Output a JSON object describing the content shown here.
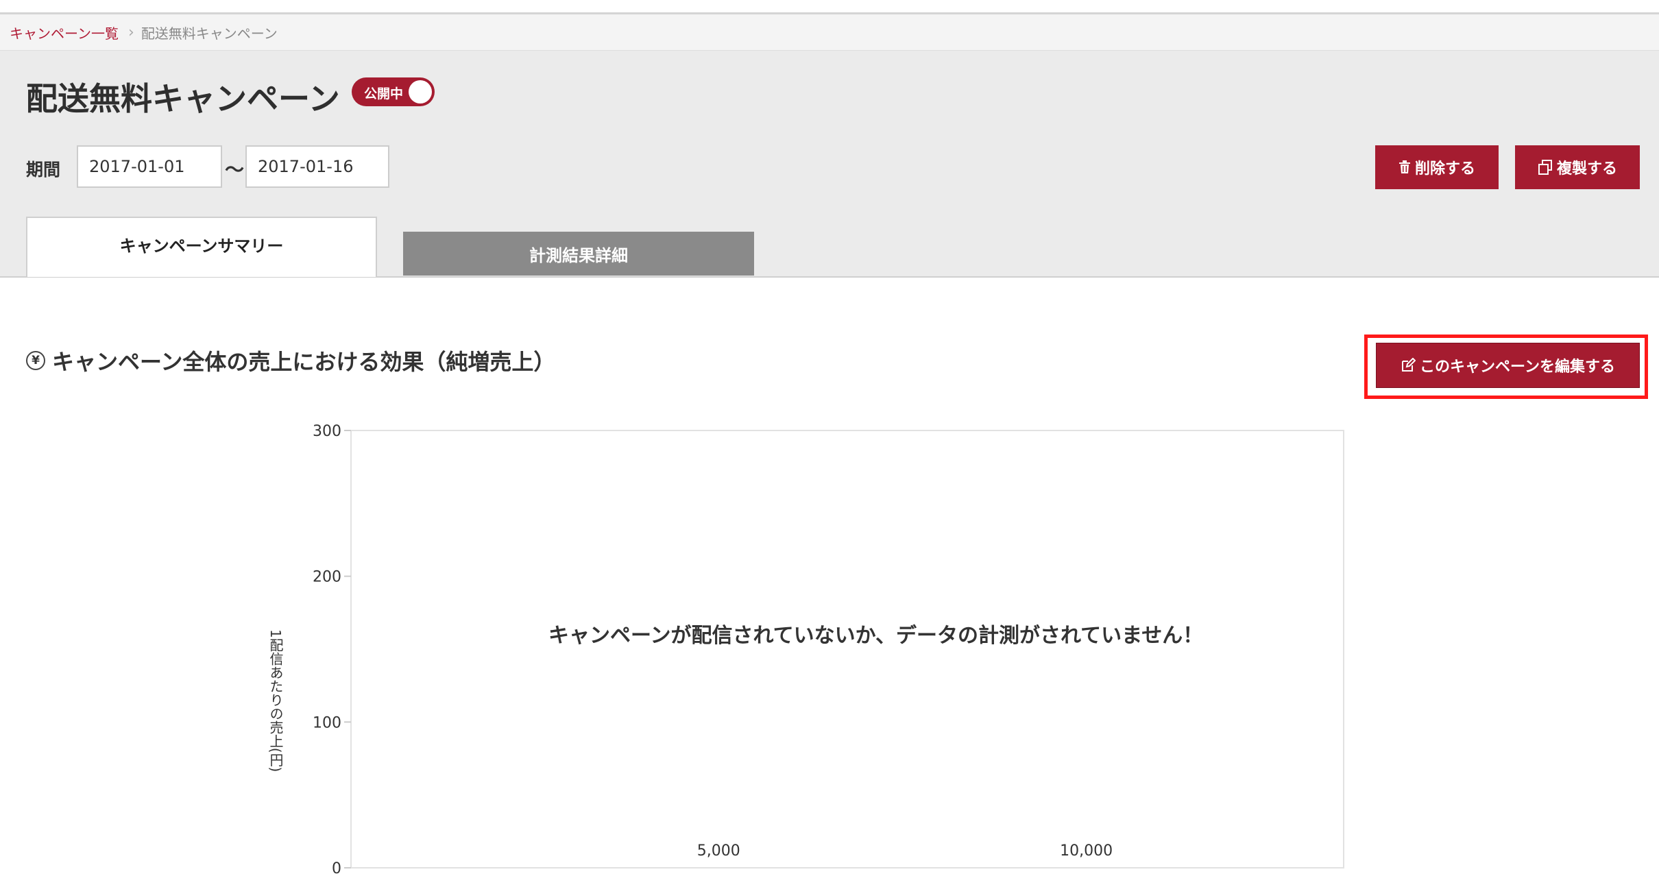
{
  "breadcrumb": {
    "parent": "キャンペーン一覧",
    "separator": "›",
    "current": "配送無料キャンペーン"
  },
  "page": {
    "title": "配送無料キャンペーン",
    "status_label": "公開中",
    "status_on": true
  },
  "period": {
    "label": "期間",
    "start": "2017-01-01",
    "separator": "〜",
    "end": "2017-01-16"
  },
  "actions": {
    "delete_label": "削除する",
    "copy_label": "複製する",
    "edit_label": "このキャンペーンを編集する"
  },
  "tabs": [
    {
      "label": "キャンペーンサマリー",
      "active": true
    },
    {
      "label": "計測結果詳細",
      "active": false
    }
  ],
  "section": {
    "title": "キャンペーン全体の売上における効果（純増売上）",
    "icon": "yen-icon"
  },
  "chart_data": {
    "type": "scatter",
    "title": "",
    "xlabel": "",
    "ylabel": "1配信あたりの売上(円)",
    "y_ticks": [
      0,
      100,
      200,
      300
    ],
    "x_ticks": [
      "5,000",
      "10,000"
    ],
    "x_tick_values": [
      5000,
      10000
    ],
    "ylim": [
      0,
      300
    ],
    "xlim": [
      0,
      13500
    ],
    "series": [],
    "message": "キャンペーンが配信されていないか、データの計測がされていません！"
  },
  "colors": {
    "accent": "#a51c30",
    "highlight": "#ff1a1a",
    "tab_inactive": "#8a8a8a"
  }
}
